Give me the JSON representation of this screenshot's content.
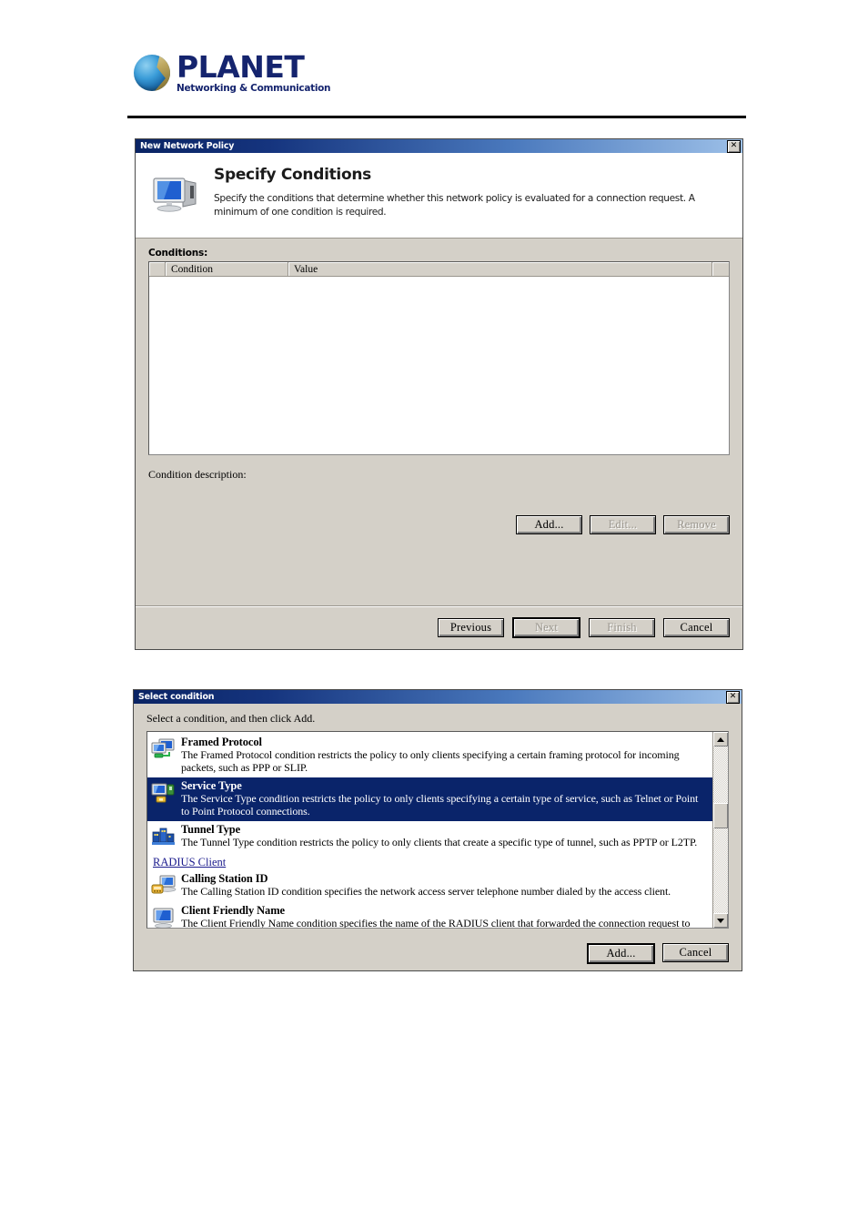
{
  "brand": {
    "name": "PLANET",
    "tagline": "Networking & Communication",
    "logo_icon": "planet-globe-logo",
    "accent_color": "#15246e"
  },
  "policy_dialog": {
    "title": "New Network Policy",
    "close_label": "✕",
    "header_icon": "computer-monitor-icon",
    "heading": "Specify Conditions",
    "description": "Specify the conditions that determine whether this network policy is evaluated for a connection request. A minimum of one condition is required.",
    "conditions_label": "Conditions:",
    "table": {
      "columns": [
        "",
        "Condition",
        "Value",
        ""
      ],
      "rows": []
    },
    "condition_description_label": "Condition description:",
    "condition_description_value": "",
    "buttons": {
      "add": "Add...",
      "edit": "Edit...",
      "remove": "Remove"
    },
    "footer_buttons": {
      "previous": "Previous",
      "next": "Next",
      "finish": "Finish",
      "cancel": "Cancel"
    }
  },
  "select_dialog": {
    "title": "Select condition",
    "close_label": "✕",
    "prompt": "Select a condition, and then click Add.",
    "items": [
      {
        "type": "condition",
        "icon": "framed-protocol-icon",
        "name": "Framed Protocol",
        "description": "The Framed Protocol condition restricts the policy to only clients specifying a certain framing protocol for incoming packets, such as PPP or SLIP.",
        "selected": false
      },
      {
        "type": "condition",
        "icon": "service-type-icon",
        "name": "Service Type",
        "description": "The Service Type condition restricts the policy to only clients specifying a certain type of service, such as Telnet or Point to Point Protocol connections.",
        "selected": true
      },
      {
        "type": "condition",
        "icon": "tunnel-type-icon",
        "name": "Tunnel Type",
        "description": "The Tunnel Type condition restricts the policy to only clients that create a specific type of tunnel, such as PPTP or L2TP.",
        "selected": false
      },
      {
        "type": "group",
        "name": "RADIUS Client"
      },
      {
        "type": "condition",
        "icon": "calling-station-id-icon",
        "name": "Calling Station ID",
        "description": "The Calling Station ID condition specifies the network access server telephone number dialed by the access client.",
        "selected": false
      },
      {
        "type": "condition",
        "icon": "client-friendly-name-icon",
        "name": "Client Friendly Name",
        "description": "The Client Friendly Name condition specifies the name of the RADIUS client that forwarded the connection request to NPS.",
        "selected": false
      }
    ],
    "scrollbar": {
      "up_icon": "scroll-up-arrow-icon",
      "down_icon": "scroll-down-arrow-icon"
    },
    "buttons": {
      "add": "Add...",
      "cancel": "Cancel"
    }
  }
}
